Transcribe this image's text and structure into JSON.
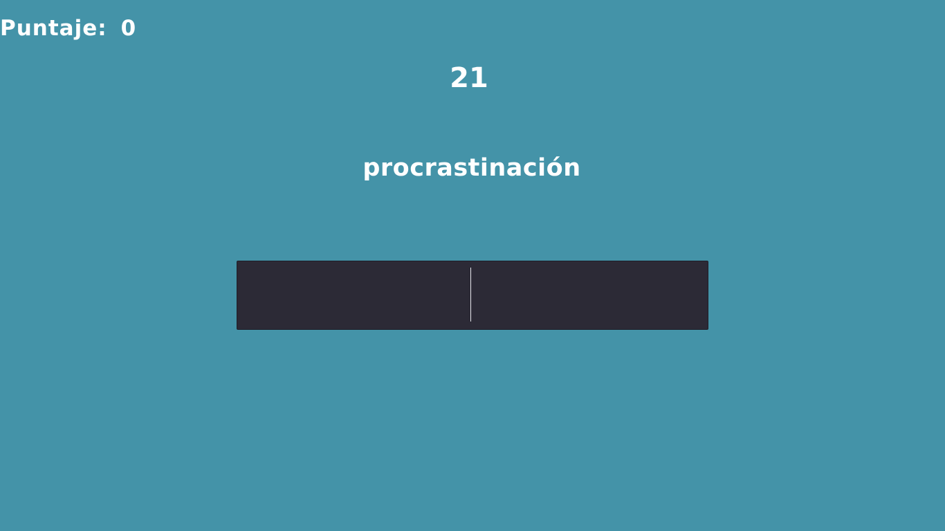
{
  "hud": {
    "score_label": "Puntaje",
    "score_separator": ":",
    "score_value": "0",
    "timer": "21"
  },
  "challenge": {
    "word": "procrastinación"
  },
  "answer": {
    "value": "",
    "placeholder": ""
  },
  "colors": {
    "background": "#4493a8",
    "input_background": "#2c2a36",
    "text": "#ffffff"
  }
}
